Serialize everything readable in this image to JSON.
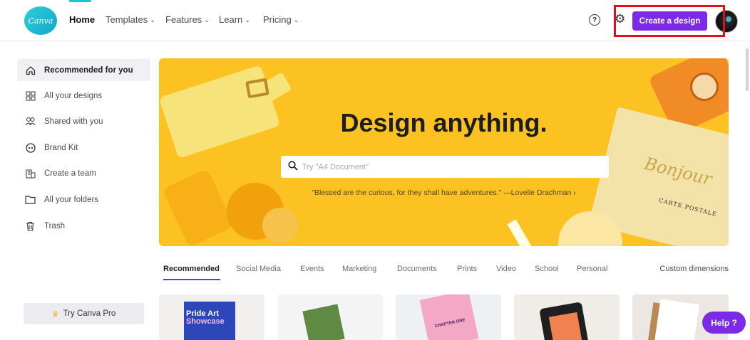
{
  "brand": {
    "logo_text": "Canva",
    "accent": "#7d2ae8",
    "teal": "#18c6d2"
  },
  "nav": {
    "home": "Home",
    "items": [
      {
        "label": "Templates",
        "icon": "chevron-down-icon"
      },
      {
        "label": "Features",
        "icon": "chevron-down-icon"
      },
      {
        "label": "Learn",
        "icon": "chevron-down-icon"
      },
      {
        "label": "Pricing",
        "icon": "chevron-down-icon"
      }
    ],
    "help_icon": "?",
    "create_button": "Create a design"
  },
  "sidebar": {
    "items": [
      {
        "label": "Recommended for you",
        "icon": "home-icon"
      },
      {
        "label": "All your designs",
        "icon": "grid-icon"
      },
      {
        "label": "Shared with you",
        "icon": "people-icon"
      },
      {
        "label": "Brand Kit",
        "icon": "brand-kit-icon"
      },
      {
        "label": "Create a team",
        "icon": "building-icon"
      },
      {
        "label": "All your folders",
        "icon": "folder-icon"
      },
      {
        "label": "Trash",
        "icon": "trash-icon"
      }
    ],
    "try_pro": "Try Canva Pro"
  },
  "hero": {
    "title": "Design anything.",
    "search_placeholder": "Try \"A4 Document\"",
    "quote": "\"Blessed are the curious, for they shall have adventures.\" —Lovelle Drachman ›",
    "postcard_text": "Bonjour",
    "postcard_sub": "CARTE POSTALE",
    "background": "#fbc221"
  },
  "tabs": {
    "items": [
      "Recommended",
      "Social Media",
      "Events",
      "Marketing",
      "Documents",
      "Prints",
      "Video",
      "School",
      "Personal"
    ],
    "custom": "Custom dimensions"
  },
  "thumbnails": {
    "t1_line1": "Pride Art",
    "t1_line2": "Showcase",
    "t3_text": "CHAPTER ONE"
  },
  "help_button": "Help ?"
}
